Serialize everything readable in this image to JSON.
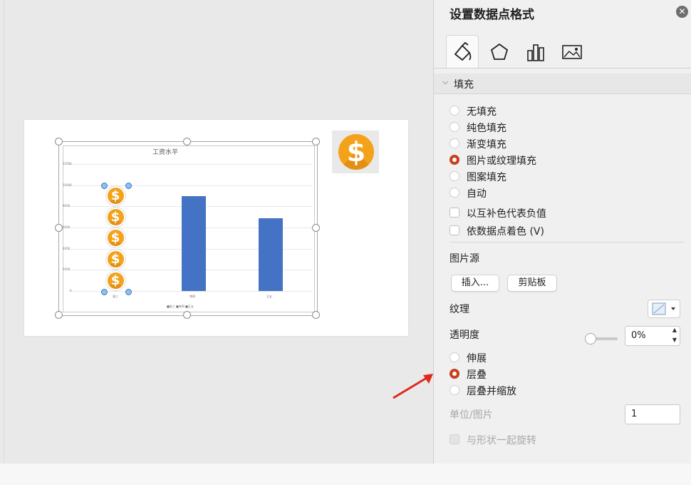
{
  "chart": {
    "title": "工资水平",
    "y_ticks": [
      "12000",
      "10000",
      "8000",
      "6000",
      "4000",
      "2000",
      "0"
    ],
    "categories": [
      "张三",
      "李四",
      "王五"
    ],
    "legend": "■张三 ■李四 ■王五"
  },
  "chart_data": {
    "type": "bar",
    "title": "工资水平",
    "categories": [
      "张三",
      "李四",
      "王五"
    ],
    "values": [
      10000,
      9000,
      6900
    ],
    "ylim": [
      0,
      12000
    ]
  },
  "panel": {
    "title": "设置数据点格式",
    "close_icon": "close-icon",
    "tabs": [
      "fill-line-icon",
      "effects-icon",
      "series-options-icon",
      "picture-icon"
    ],
    "section": "填充",
    "fill_options": [
      "无填充",
      "纯色填充",
      "渐变填充",
      "图片或纹理填充",
      "图案填充",
      "自动"
    ],
    "fill_selected": 3,
    "checkboxes": [
      "以互补色代表负值",
      "依数据点着色 (V)"
    ],
    "picture_source_label": "图片源",
    "insert_button": "插入...",
    "clipboard_button": "剪贴板",
    "texture_label": "纹理",
    "transparency_label": "透明度",
    "transparency_value": "0%",
    "stack_options": [
      "伸展",
      "层叠",
      "层叠并缩放"
    ],
    "stack_selected": 1,
    "units_label": "单位/图片",
    "units_value": "1",
    "rotate_label": "与形状一起旋转"
  },
  "colors": {
    "accent": "#c9401e",
    "bar": "#4472c4",
    "coin": "#f3a21a",
    "arrow": "#e0281c"
  }
}
